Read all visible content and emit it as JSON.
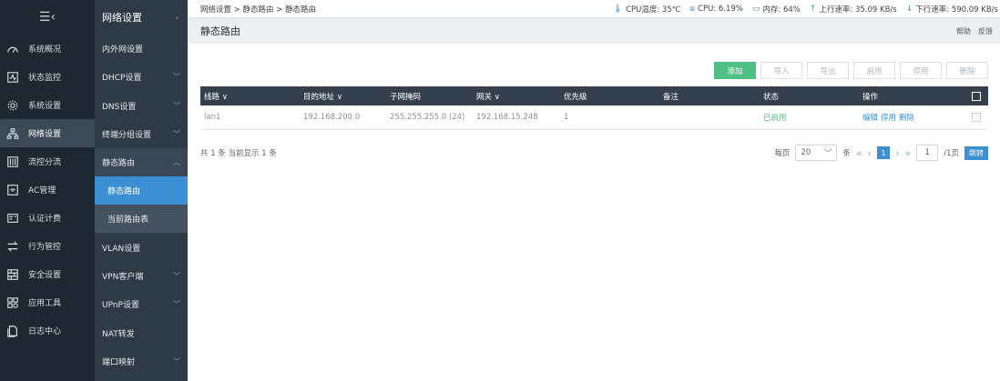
{
  "nav_primary": {
    "toggle_icon": "menu-collapse-icon",
    "items": [
      {
        "label": "系统概况",
        "icon": "dashboard-icon"
      },
      {
        "label": "状态监控",
        "icon": "monitor-icon"
      },
      {
        "label": "系统设置",
        "icon": "gear-icon"
      },
      {
        "label": "网络设置",
        "icon": "network-icon"
      },
      {
        "label": "流控分流",
        "icon": "flow-control-icon"
      },
      {
        "label": "AC管理",
        "icon": "wifi-ap-icon"
      },
      {
        "label": "认证计费",
        "icon": "auth-card-icon"
      },
      {
        "label": "行为管控",
        "icon": "swap-arrows-icon"
      },
      {
        "label": "安全设置",
        "icon": "firewall-icon"
      },
      {
        "label": "应用工具",
        "icon": "apps-grid-icon"
      },
      {
        "label": "日志中心",
        "icon": "log-doc-icon"
      }
    ]
  },
  "nav_secondary": {
    "title": "网络设置",
    "items": [
      {
        "label": "内外网设置"
      },
      {
        "label": "DHCP设置"
      },
      {
        "label": "DNS设置"
      },
      {
        "label": "终端分组设置"
      },
      {
        "label": "静态路由"
      },
      {
        "label": "静态路由"
      },
      {
        "label": "当前路由表"
      },
      {
        "label": "VLAN设置"
      },
      {
        "label": "VPN客户端"
      },
      {
        "label": "UPnP设置"
      },
      {
        "label": "NAT转发"
      },
      {
        "label": "端口映射"
      }
    ]
  },
  "topbar": {
    "breadcrumb": "网络设置 > 静态路由 > 静态路由",
    "cpu_temp": "CPU温度: 35℃",
    "cpu": "CPU: 6.19%",
    "memory": "内存: 64%",
    "upload": "上行速率: 35.09 KB/s",
    "download": "下行速率: 590.09 KB/s"
  },
  "header": {
    "title": "静态路由",
    "help": "帮助",
    "feedback": "反馈"
  },
  "toolbar": {
    "add": "添加",
    "import": "导入",
    "export": "导出",
    "enable": "启用",
    "disable": "停用",
    "delete": "删除"
  },
  "table": {
    "columns": [
      "线路 ∨",
      "目的地址 ∨",
      "子网掩码",
      "网关 ∨",
      "优先级",
      "备注",
      "状态",
      "操作"
    ],
    "rows": [
      {
        "line": "lan1",
        "dest": "192.168.200.0",
        "mask": "255.255.255.0 (24)",
        "gateway": "192.168.15.248",
        "priority": "1",
        "note": "",
        "status": "已启用",
        "op_edit": "编辑",
        "op_disable": "停用",
        "op_delete": "删除"
      }
    ]
  },
  "pagination": {
    "summary": "共 1 条 当前显示 1 条",
    "per_page_label": "每页",
    "per_page_value": "20",
    "per_page_unit": "条",
    "current_page": "1",
    "page_input": "1",
    "total_pages": "/1页",
    "jump": "跳转"
  },
  "colors": {
    "nav_bg": "#1e2833",
    "subnav_bg": "#2e3a46",
    "accent_blue": "#3d8fd3",
    "accent_green": "#4ec084",
    "table_header": "#34404d"
  }
}
